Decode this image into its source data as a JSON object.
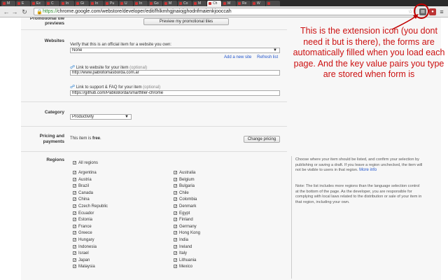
{
  "browser": {
    "tabs": [
      {
        "label": "M",
        "active": false
      },
      {
        "label": "E",
        "active": false
      },
      {
        "label": "Ex",
        "active": false
      },
      {
        "label": "C",
        "active": false
      },
      {
        "label": "In",
        "active": false
      },
      {
        "label": "Gi",
        "active": false
      },
      {
        "label": "In",
        "active": false
      },
      {
        "label": "Pu",
        "active": false
      },
      {
        "label": "U",
        "active": false
      },
      {
        "label": "In",
        "active": false
      },
      {
        "label": "Go",
        "active": false
      },
      {
        "label": "M",
        "active": false
      },
      {
        "label": "Co",
        "active": false
      },
      {
        "label": "M",
        "active": false
      },
      {
        "label": "Ch",
        "active": true
      },
      {
        "label": "M",
        "active": false
      },
      {
        "label": "Re",
        "active": false
      },
      {
        "label": "W",
        "active": false
      },
      {
        "label": "",
        "active": false
      }
    ],
    "url_scheme": "https://",
    "url_rest": "chrome.google.com/webstore/developer/edit/fhlkmhgjnaiojghodnfmaienkjooccah"
  },
  "form": {
    "promo_label": "Promotional tile previews",
    "promo_button": "Preview my promotional tiles",
    "websites_label": "Websites",
    "verify_text": "Verify that this is an official item for a website you own:",
    "verify_select": "None",
    "add_new_site": "Add a new site",
    "refresh_list": "Refresh list",
    "website_link_label": "Link to website for your item",
    "website_link_optional": "(optional)",
    "website_link_value": "http://www.pablotomasborda.com.ar",
    "support_link_label": "Link to support & FAQ for your item",
    "support_link_optional": "(optional)",
    "support_link_value": "https://github.com/PabloBorda/smartfiller-chrome",
    "category_label": "Category",
    "category_value": "Productivity",
    "pricing_label": "Pricing and payments",
    "pricing_text_before": "This item is",
    "pricing_free": "free",
    "pricing_text_after": ".",
    "change_pricing": "Change pricing",
    "regions_label": "Regions",
    "all_regions": "All regions",
    "regions_col1": [
      "Argentina",
      "Austria",
      "Brazil",
      "Canada",
      "China",
      "Czech Republic",
      "Ecuador",
      "Estonia",
      "France",
      "Greece",
      "Hungary",
      "Indonesia",
      "Israel",
      "Japan",
      "Malaysia"
    ],
    "regions_col2": [
      "Australia",
      "Belgium",
      "Bulgaria",
      "Chile",
      "Colombia",
      "Denmark",
      "Egypt",
      "Finland",
      "Germany",
      "Hong Kong",
      "India",
      "Ireland",
      "Italy",
      "Lithuania",
      "Mexico"
    ]
  },
  "sidebar_help": {
    "regions_help": "Choose where your item should be listed, and confirm your selection by publishing or saving a draft. If you leave a region unchecked, the item will not be visible to users in that region.",
    "more_info": "More info",
    "note": "Note: The list includes more regions than the language selection control at the bottom of the page. As the developer, you are responsible for complying with local laws related to the distribution or sale of your item in that region, including your own."
  },
  "annotation": {
    "text": "This is the extension icon (you dont need it but is there), the forms are automatically filled when you load each page. And the key value pairs you type are stored when form is",
    "color": "#cc1111"
  }
}
